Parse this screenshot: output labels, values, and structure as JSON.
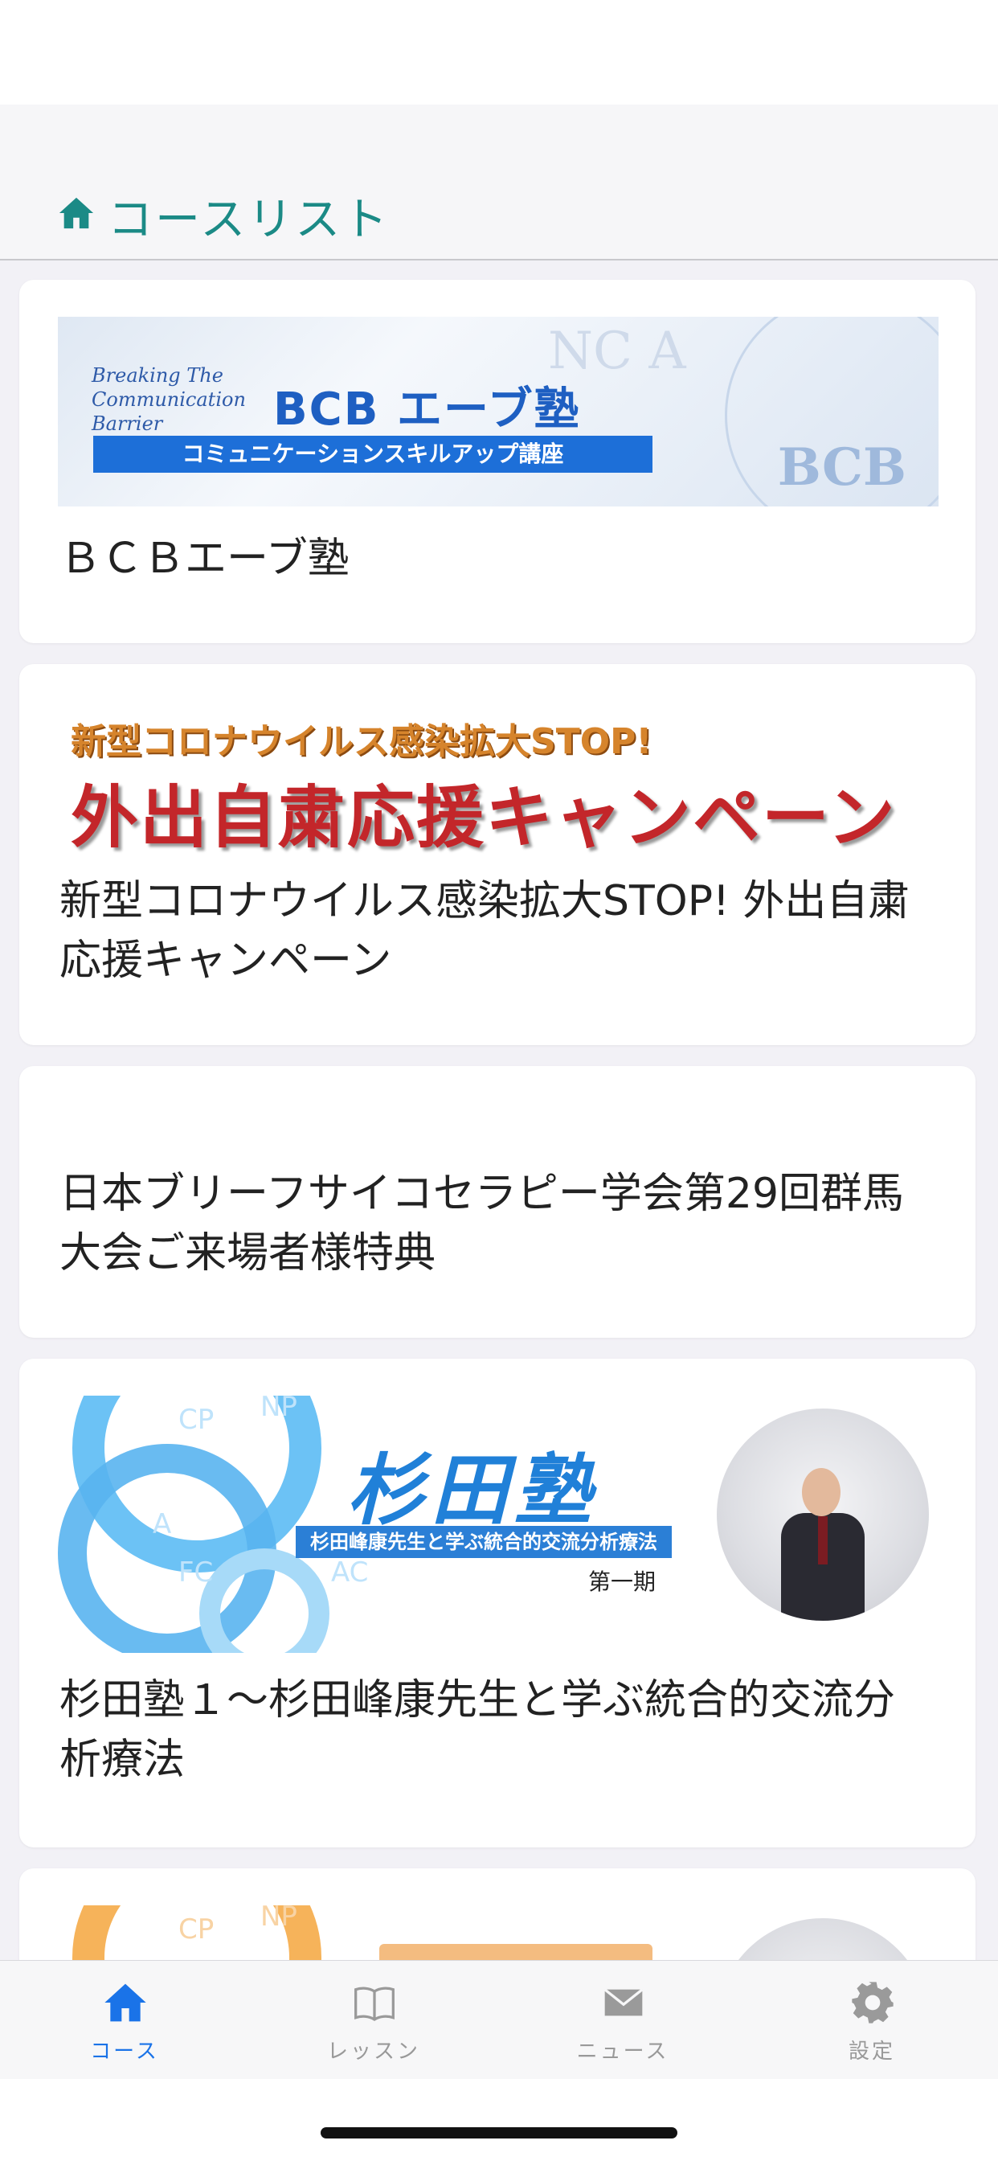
{
  "header": {
    "title": "コースリスト"
  },
  "courses": [
    {
      "label": "ＢＣＢエーブ塾",
      "banner": {
        "small_lines": [
          "Breaking The",
          "Communication",
          "Barrier"
        ],
        "title": "BCB エーブ塾",
        "strip": "コミュニケーションスキルアップ講座",
        "seal": "BCB",
        "watermark": "NC A"
      }
    },
    {
      "label": "新型コロナウイルス感染拡大STOP! 外出自粛応援キャンペーン",
      "banner": {
        "top": "新型コロナウイルス感染拡大STOP!",
        "main": "外出自粛応援キャンペーン"
      }
    },
    {
      "label": "日本ブリーフサイコセラピー学会第29回群馬大会ご来場者様特典"
    },
    {
      "label": "杉田塾１～杉田峰康先生と学ぶ統合的交流分析療法",
      "banner": {
        "title": "杉田塾",
        "strip": "杉田峰康先生と学ぶ統合的交流分析療法",
        "sub": "第一期",
        "letters": [
          "CP",
          "NP",
          "A",
          "FC",
          "AC"
        ]
      }
    }
  ],
  "tabbar": {
    "tabs": [
      {
        "label": "コース",
        "icon": "home-icon",
        "active": true
      },
      {
        "label": "レッスン",
        "icon": "book-icon",
        "active": false
      },
      {
        "label": "ニュース",
        "icon": "envelope-icon",
        "active": false
      },
      {
        "label": "設定",
        "icon": "gear-icon",
        "active": false
      }
    ]
  },
  "colors": {
    "accent": "#1b8a86",
    "tab_active": "#1a73e8",
    "tab_inactive": "#999999"
  }
}
